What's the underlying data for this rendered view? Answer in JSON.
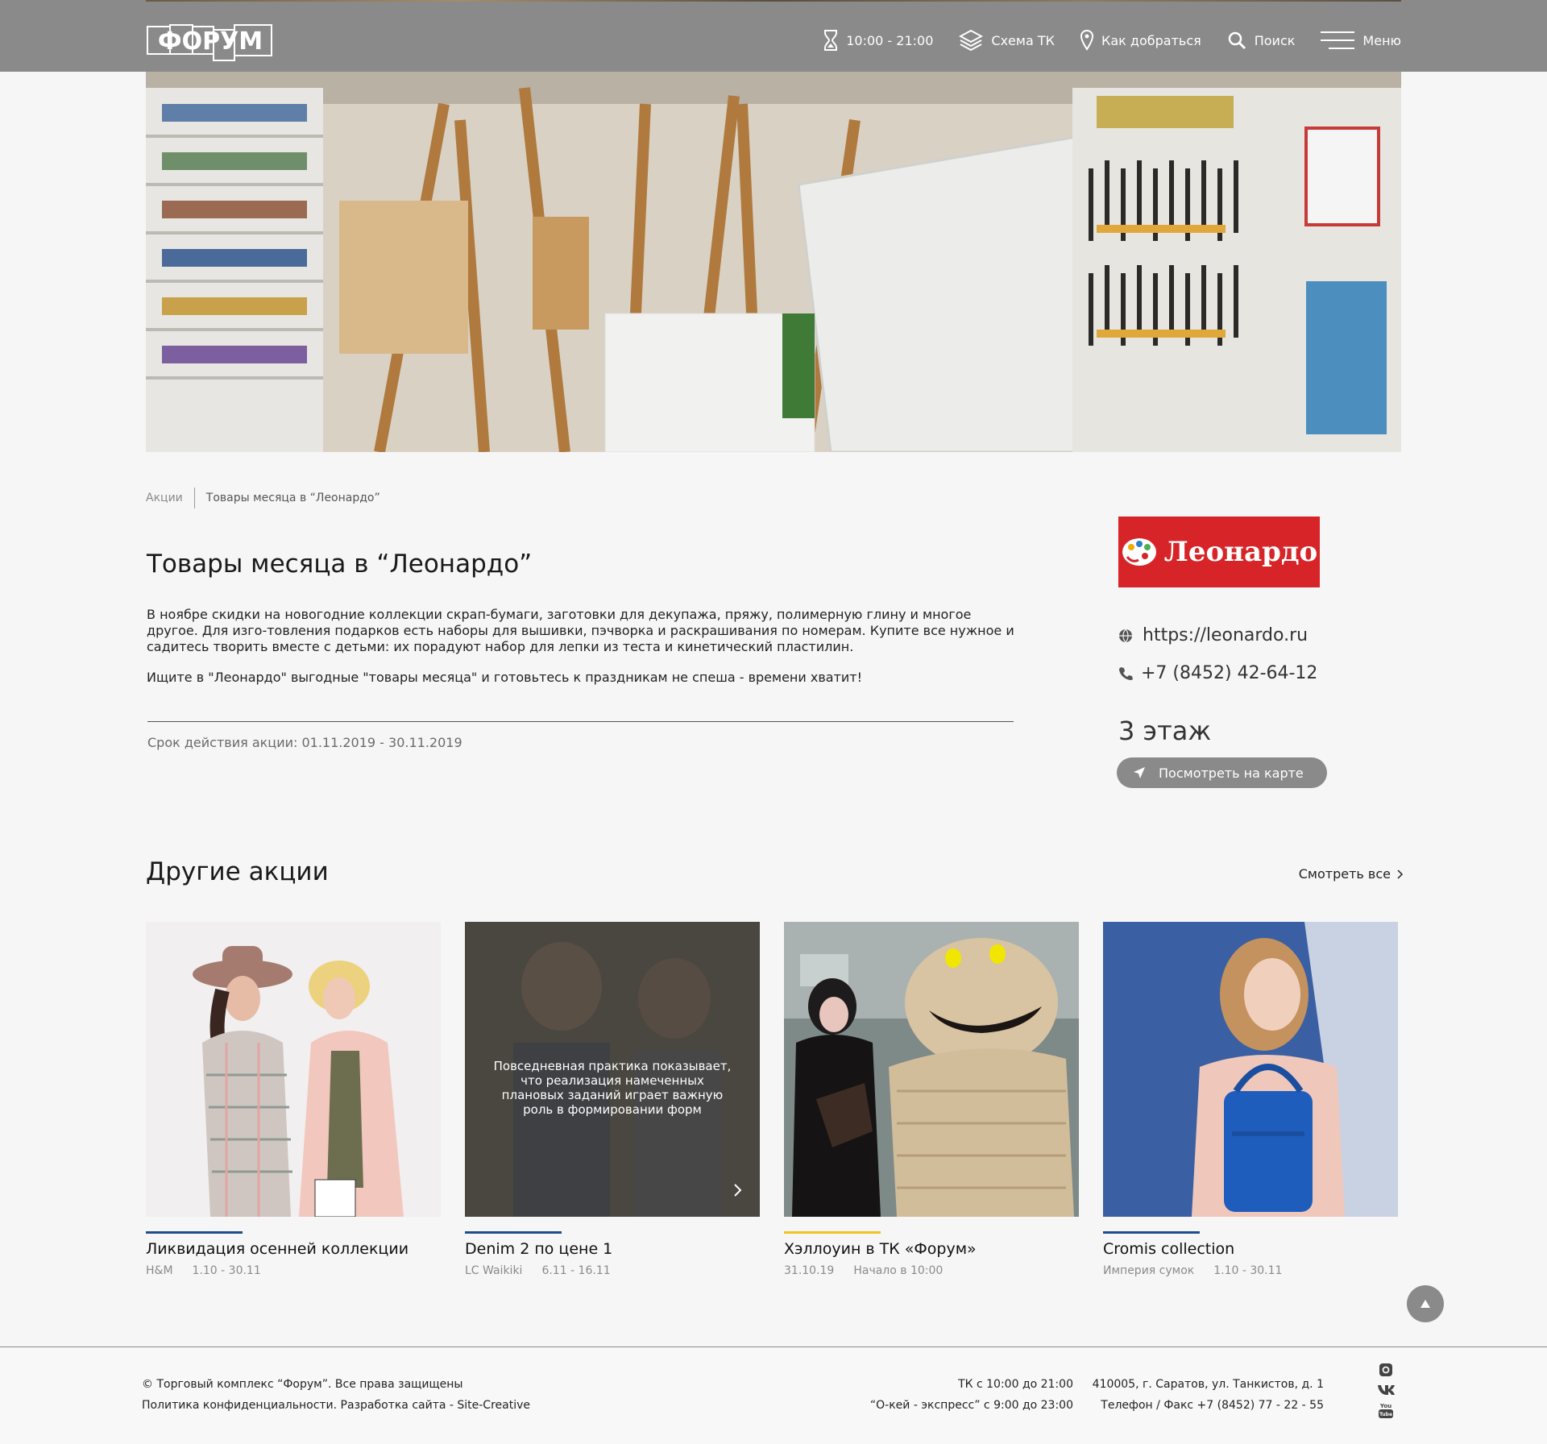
{
  "header": {
    "logo_text": "ФОРУМ",
    "hours": "10:00 - 21:00",
    "scheme": "Схема ТК",
    "directions": "Как добраться",
    "search": "Поиск",
    "menu": "Меню"
  },
  "breadcrumb": {
    "parent": "Акции",
    "current": "Товары месяца в “Леонардо”"
  },
  "promo": {
    "title": "Товары месяца в “Леонардо”",
    "paragraph1": "В ноябре скидки на новогодние коллекции скрап-бумаги, заготовки для декупажа, пряжу, полимерную глину и многое другое. Для изго-товления подарков есть наборы для вышивки, пэчворка и раскрашивания по номерам. Купите все нужное и садитесь творить вместе с детьми: их порадуют набор для лепки из теста и кинетический пластилин.",
    "paragraph2": "Ищите в \"Леонардо\" выгодные \"товары месяца\" и готовьтесь к праздникам не спеша - времени хватит!",
    "period": "Срок действия акции: 01.11.2019 - 30.11.2019"
  },
  "store": {
    "logo_text": "Леонардо",
    "website": "https://leonardo.ru",
    "phone": "+7 (8452) 42-64-12",
    "floor": "3 этаж",
    "map_button": "Посмотреть на карте"
  },
  "other_promos": {
    "title": "Другие акции",
    "see_all": "Смотреть все",
    "cards": [
      {
        "title": "Ликвидация осенней коллекции",
        "store": "H&M",
        "date": "1.10 - 30.11",
        "accent": "#1f4e8c"
      },
      {
        "title": "Denim 2 по цене 1",
        "store": "LC Waikiki",
        "date": "6.11 - 16.11",
        "accent": "#1f4e8c",
        "caption": "Повседневная практика показывает, что реализация намеченных плановых заданий играет важную роль в формировании форм"
      },
      {
        "title": "Хэллоуин в ТК «Форум»",
        "store": "31.10.19",
        "date": "Начало в 10:00",
        "accent": "#f2c31b"
      },
      {
        "title": "Cromis collection",
        "store": "Империя сумок",
        "date": "1.10 - 30.11",
        "accent": "#1f4e8c"
      }
    ]
  },
  "footer": {
    "copyright": "© Торговый комплекс “Форум”. Все права защищены",
    "policy": "Политика конфиденциальности. Разработка сайта - Site-Creative",
    "hours_mall": "ТК с 10:00 до 21:00",
    "hours_express": "“О-кей - экспресс” с 9:00 до 23:00",
    "address": "410005, г. Саратов, ул. Танкистов, д. 1",
    "phone": "Телефон / Факс +7 (8452) 77 - 22 - 55",
    "social": [
      "instagram-icon",
      "vk-icon",
      "youtube-icon"
    ]
  },
  "colors": {
    "header_bg": "#8b8a8a",
    "store_logo_bg": "#d72428",
    "accent_blue": "#1f4e8c",
    "accent_yellow": "#f2c31b"
  }
}
